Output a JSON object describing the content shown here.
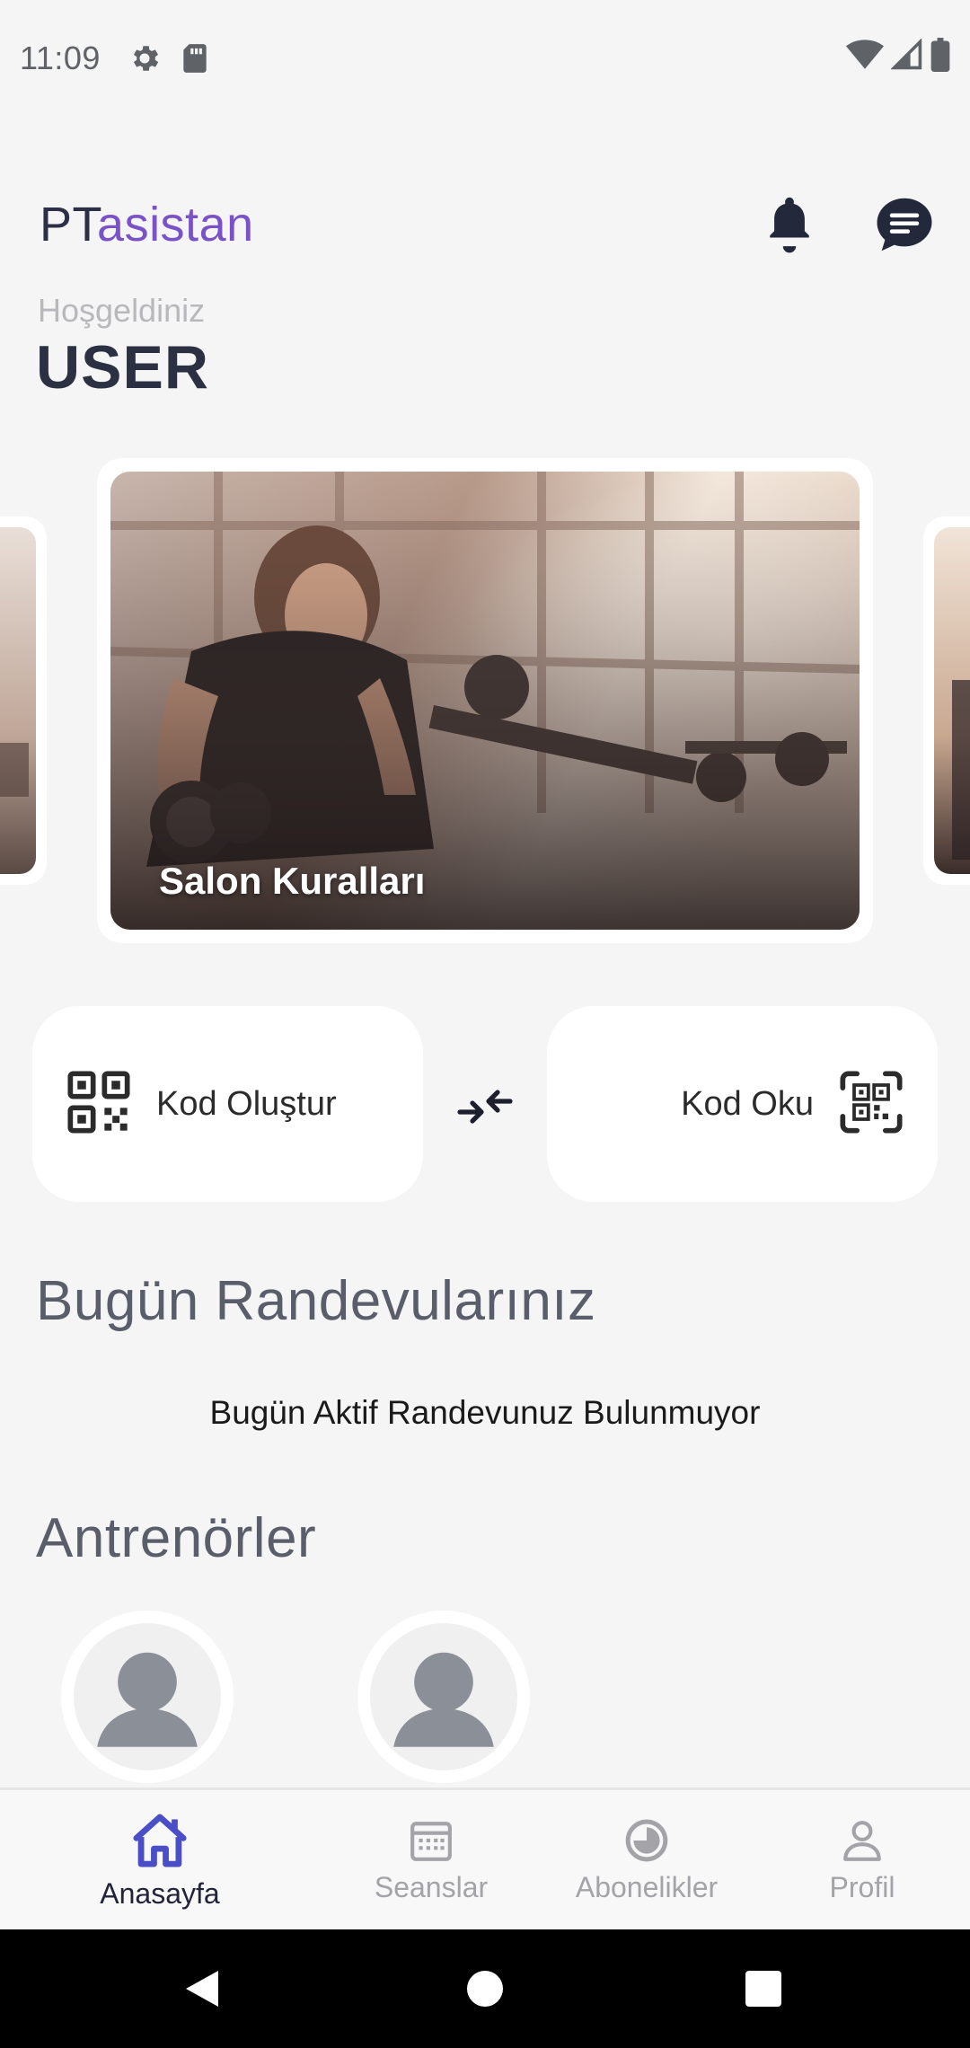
{
  "status_bar": {
    "time": "11:09",
    "icons": [
      "settings-icon",
      "sd-card-icon",
      "wifi-icon",
      "signal-icon",
      "battery-icon"
    ]
  },
  "header": {
    "logo_part1": "PT",
    "logo_part2": "asistan",
    "brand_color": "#7a52c8",
    "actions": [
      "bell-icon",
      "chat-icon"
    ]
  },
  "welcome": {
    "greeting": "Hoşgeldiniz",
    "user": "USER"
  },
  "carousel": {
    "slides": [
      {
        "caption": "Salon Kuralları"
      }
    ]
  },
  "code_actions": {
    "create_label": "Kod Oluştur",
    "read_label": "Kod Oku"
  },
  "appointments": {
    "title": "Bugün Randevularınız",
    "empty_message": "Bugün Aktif Randevunuz Bulunmuyor"
  },
  "trainers": {
    "title": "Antrenörler",
    "count_shown": 2
  },
  "bottom_nav": {
    "items": [
      {
        "label": "Anasayfa",
        "icon": "home-icon",
        "active": true
      },
      {
        "label": "Seanslar",
        "icon": "calendar-icon",
        "active": false
      },
      {
        "label": "Abonelikler",
        "icon": "subscription-icon",
        "active": false
      },
      {
        "label": "Profil",
        "icon": "person-icon",
        "active": false
      }
    ],
    "active_color": "#4a4fc7"
  }
}
